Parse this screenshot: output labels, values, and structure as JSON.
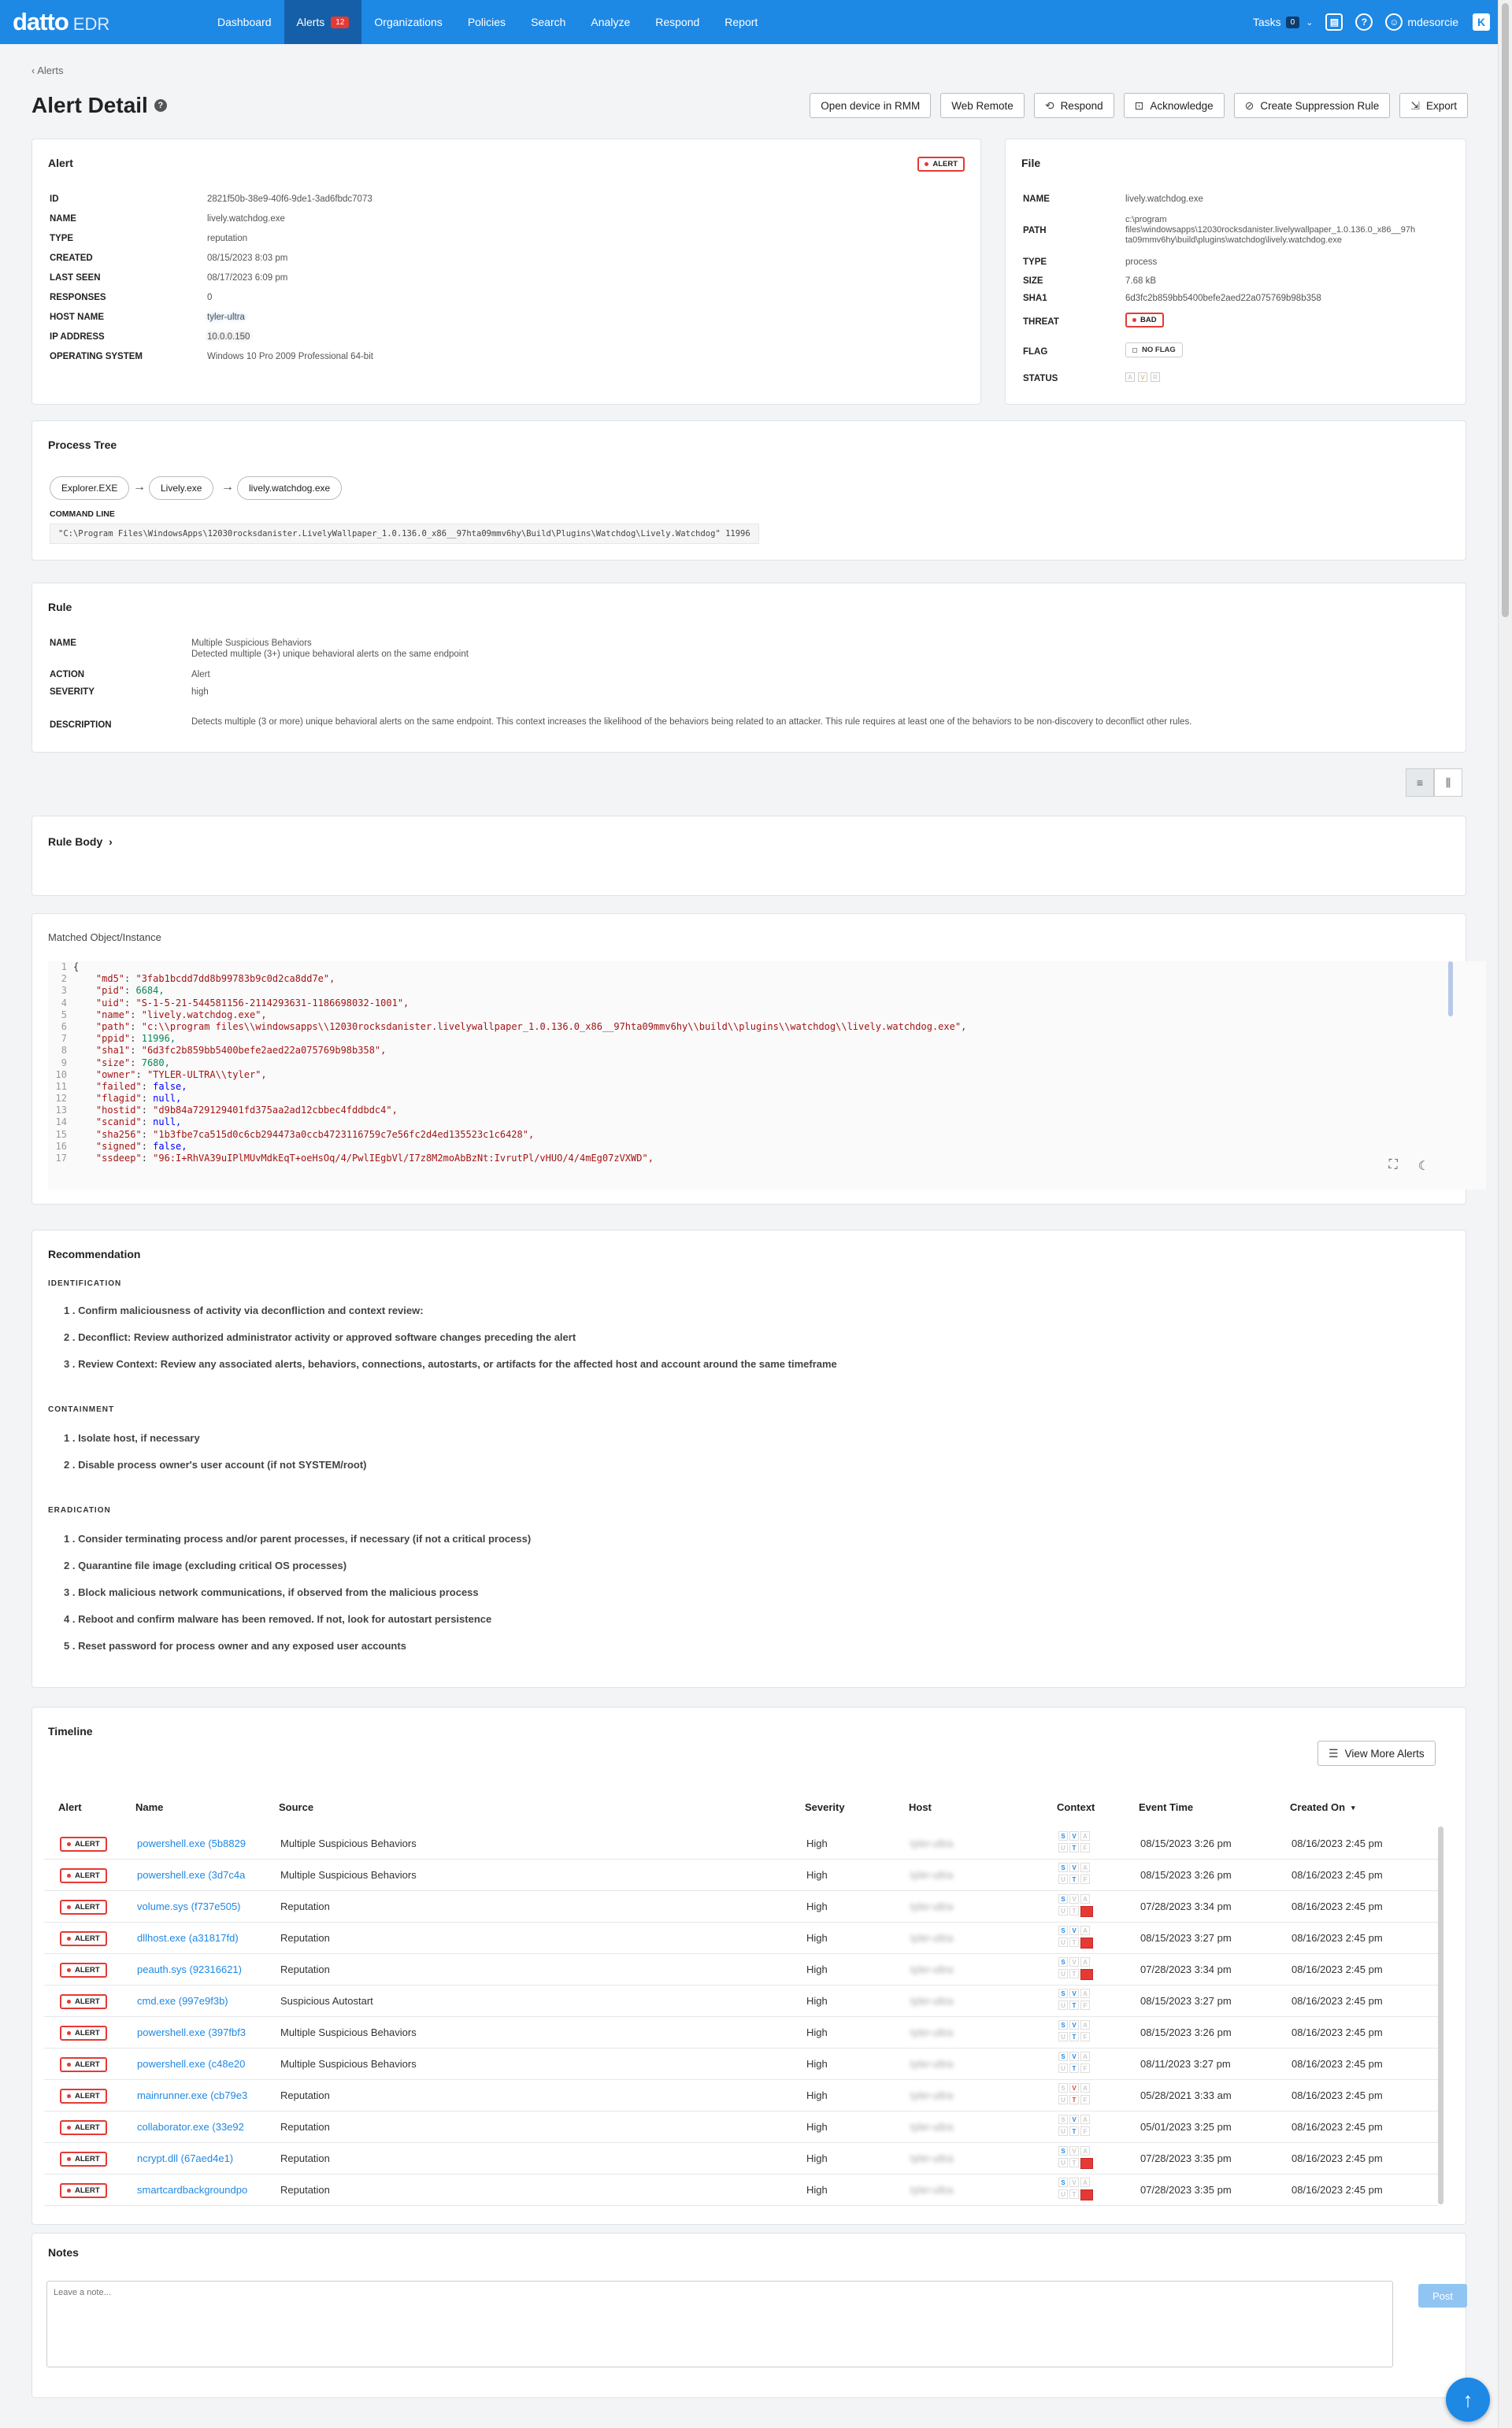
{
  "app": {
    "brand": "datto",
    "product": "EDR"
  },
  "nav": [
    {
      "label": "Dashboard"
    },
    {
      "label": "Alerts",
      "badge": "12"
    },
    {
      "label": "Organizations"
    },
    {
      "label": "Policies"
    },
    {
      "label": "Search"
    },
    {
      "label": "Analyze"
    },
    {
      "label": "Respond"
    },
    {
      "label": "Report"
    }
  ],
  "topbar": {
    "tasks_label": "Tasks",
    "tasks_count": "0",
    "username": "mdesorcie"
  },
  "breadcrumb": "Alerts",
  "page_title": "Alert Detail",
  "actions": {
    "open_rmm": "Open device in RMM",
    "web_remote": "Web Remote",
    "respond": "Respond",
    "acknowledge": "Acknowledge",
    "suppression": "Create Suppression Rule",
    "export": "Export"
  },
  "alert_card": {
    "title": "Alert",
    "badge": "ALERT",
    "fields": [
      {
        "k": "ID",
        "v": "2821f50b-38e9-40f6-9de1-3ad6fbdc7073"
      },
      {
        "k": "NAME",
        "v": "lively.watchdog.exe"
      },
      {
        "k": "TYPE",
        "v": "reputation"
      },
      {
        "k": "CREATED",
        "v": "08/15/2023 8:03 pm"
      },
      {
        "k": "LAST SEEN",
        "v": "08/17/2023 6:09 pm"
      },
      {
        "k": "RESPONSES",
        "v": "0"
      },
      {
        "k": "HOST NAME",
        "v": "tyler-ultra"
      },
      {
        "k": "IP ADDRESS",
        "v": "10.0.0.150"
      },
      {
        "k": "OPERATING SYSTEM",
        "v": "Windows 10 Pro 2009 Professional 64-bit"
      }
    ]
  },
  "file_card": {
    "title": "File",
    "name": "lively.watchdog.exe",
    "path": "c:\\program files\\windowsapps\\12030rocksdanister.livelywallpaper_1.0.136.0_x86__97hta09mmv6hy\\build\\plugins\\watchdog\\lively.watchdog.exe",
    "path_line1": "c:\\program",
    "path_line2": "files\\windowsapps\\12030rocksdanister.livelywallpaper_1.0.136.0_x86__97h",
    "path_line3": "ta09mmv6hy\\build\\plugins\\watchdog\\lively.watchdog.exe",
    "type": "process",
    "size": "7.68 kB",
    "sha1": "6d3fc2b859bb5400befe2aed22a075769b98b358",
    "threat": "BAD",
    "flag": "NO FLAG",
    "labels": {
      "name": "NAME",
      "path": "PATH",
      "type": "TYPE",
      "size": "SIZE",
      "sha1": "SHA1",
      "threat": "THREAT",
      "flag": "FLAG",
      "status": "STATUS"
    }
  },
  "process_tree": {
    "title": "Process Tree",
    "nodes": [
      "Explorer.EXE",
      "Lively.exe",
      "lively.watchdog.exe"
    ],
    "cmd_label": "COMMAND LINE",
    "cmd": "\"C:\\Program Files\\WindowsApps\\12030rocksdanister.LivelyWallpaper_1.0.136.0_x86__97hta09mmv6hy\\Build\\Plugins\\Watchdog\\Lively.Watchdog\" 11996"
  },
  "rule": {
    "title": "Rule",
    "labels": {
      "name": "NAME",
      "action": "ACTION",
      "severity": "SEVERITY",
      "description": "DESCRIPTION"
    },
    "name": "Multiple Suspicious Behaviors",
    "name_sub": "Detected multiple (3+) unique behavioral alerts on the same endpoint",
    "action": "Alert",
    "severity": "high",
    "description": "Detects multiple (3 or more) unique behavioral alerts on the same endpoint. This context increases the likelihood of the behaviors being related to an attacker. This rule requires at least one of the behaviors to be non-discovery to deconflict other rules."
  },
  "rule_body": {
    "title": "Rule Body"
  },
  "matched": {
    "title": "Matched Object/Instance",
    "lines": [
      {
        "n": "1",
        "k": "",
        "v": "{",
        "t": "p"
      },
      {
        "n": "2",
        "k": "\"md5\"",
        "v": "\"3fab1bcdd7dd8b99783b9c0d2ca8dd7e\",",
        "t": "str"
      },
      {
        "n": "3",
        "k": "\"pid\"",
        "v": "6684,",
        "t": "num"
      },
      {
        "n": "4",
        "k": "\"uid\"",
        "v": "\"S-1-5-21-544581156-2114293631-1186698032-1001\",",
        "t": "str"
      },
      {
        "n": "5",
        "k": "\"name\"",
        "v": "\"lively.watchdog.exe\",",
        "t": "str"
      },
      {
        "n": "6",
        "k": "\"path\"",
        "v": "\"c:\\\\program files\\\\windowsapps\\\\12030rocksdanister.livelywallpaper_1.0.136.0_x86__97hta09mmv6hy\\\\build\\\\plugins\\\\watchdog\\\\lively.watchdog.exe\",",
        "t": "str"
      },
      {
        "n": "7",
        "k": "\"ppid\"",
        "v": "11996,",
        "t": "num"
      },
      {
        "n": "8",
        "k": "\"sha1\"",
        "v": "\"6d3fc2b859bb5400befe2aed22a075769b98b358\",",
        "t": "str"
      },
      {
        "n": "9",
        "k": "\"size\"",
        "v": "7680,",
        "t": "num"
      },
      {
        "n": "10",
        "k": "\"owner\"",
        "v": "\"TYLER-ULTRA\\\\tyler\",",
        "t": "str"
      },
      {
        "n": "11",
        "k": "\"failed\"",
        "v": "false,",
        "t": "lit"
      },
      {
        "n": "12",
        "k": "\"flagid\"",
        "v": "null,",
        "t": "lit"
      },
      {
        "n": "13",
        "k": "\"hostid\"",
        "v": "\"d9b84a729129401fd375aa2ad12cbbec4fddbdc4\",",
        "t": "str"
      },
      {
        "n": "14",
        "k": "\"scanid\"",
        "v": "null,",
        "t": "lit"
      },
      {
        "n": "15",
        "k": "\"sha256\"",
        "v": "\"1b3fbe7ca515d0c6cb294473a0ccb4723116759c7e56fc2d4ed135523c1c6428\",",
        "t": "str"
      },
      {
        "n": "16",
        "k": "\"signed\"",
        "v": "false,",
        "t": "lit"
      },
      {
        "n": "17",
        "k": "\"ssdeep\"",
        "v": "\"96:I+RhVA39uIPlMUvMdkEqT+oeHsOq/4/PwlIEgbVl/I7z8M2moAbBzNt:IvrutPl/vHUO/4/4mEg07zVXWD\",",
        "t": "str"
      }
    ]
  },
  "recommendation": {
    "title": "Recommendation",
    "identification_label": "IDENTIFICATION",
    "identification": [
      "1 . Confirm maliciousness of activity via deconfliction and context review:",
      "2 . Deconflict: Review authorized administrator activity or approved software changes preceding the alert",
      "3 . Review Context: Review any associated alerts, behaviors, connections, autostarts, or artifacts for the affected host and account around the same timeframe"
    ],
    "containment_label": "CONTAINMENT",
    "containment": [
      "1 . Isolate host, if necessary",
      "2 . Disable process owner's user account (if not SYSTEM/root)"
    ],
    "eradication_label": "ERADICATION",
    "eradication": [
      "1 . Consider terminating process and/or parent processes, if necessary (if not a critical process)",
      "2 . Quarantine file image (excluding critical OS processes)",
      "3 . Block malicious network communications, if observed from the malicious process",
      "4 . Reboot and confirm malware has been removed. If not, look for autostart persistence",
      "5 . Reset password for process owner and any exposed user accounts"
    ]
  },
  "timeline": {
    "title": "Timeline",
    "view_more": "View More Alerts",
    "columns": [
      "Alert",
      "Name",
      "Source",
      "Severity",
      "Host",
      "Context",
      "Event Time",
      "Created On"
    ],
    "rows": [
      {
        "alert": "ALERT",
        "name": "powershell.exe (5b8829",
        "source": "Multiple Suspicious Behaviors",
        "severity": "High",
        "host": "tyler-ultra",
        "event": "08/15/2023 3:26 pm",
        "created": "08/16/2023 2:45 pm",
        "ctx": "svt"
      },
      {
        "alert": "ALERT",
        "name": "powershell.exe (3d7c4a",
        "source": "Multiple Suspicious Behaviors",
        "severity": "High",
        "host": "tyler-ultra",
        "event": "08/15/2023 3:26 pm",
        "created": "08/16/2023 2:45 pm",
        "ctx": "svt"
      },
      {
        "alert": "ALERT",
        "name": "volume.sys (f737e505)",
        "source": "Reputation",
        "severity": "High",
        "host": "tyler-ultra",
        "event": "07/28/2023 3:34 pm",
        "created": "08/16/2023 2:45 pm",
        "ctx": "sr"
      },
      {
        "alert": "ALERT",
        "name": "dllhost.exe (a31817fd)",
        "source": "Reputation",
        "severity": "High",
        "host": "tyler-ultra",
        "event": "08/15/2023 3:27 pm",
        "created": "08/16/2023 2:45 pm",
        "ctx": "svr"
      },
      {
        "alert": "ALERT",
        "name": "peauth.sys (92316621)",
        "source": "Reputation",
        "severity": "High",
        "host": "tyler-ultra",
        "event": "07/28/2023 3:34 pm",
        "created": "08/16/2023 2:45 pm",
        "ctx": "sr"
      },
      {
        "alert": "ALERT",
        "name": "cmd.exe (997e9f3b)",
        "source": "Suspicious Autostart",
        "severity": "High",
        "host": "tyler-ultra",
        "event": "08/15/2023 3:27 pm",
        "created": "08/16/2023 2:45 pm",
        "ctx": "svt"
      },
      {
        "alert": "ALERT",
        "name": "powershell.exe (397fbf3",
        "source": "Multiple Suspicious Behaviors",
        "severity": "High",
        "host": "tyler-ultra",
        "event": "08/15/2023 3:26 pm",
        "created": "08/16/2023 2:45 pm",
        "ctx": "svt"
      },
      {
        "alert": "ALERT",
        "name": "powershell.exe (c48e20",
        "source": "Multiple Suspicious Behaviors",
        "severity": "High",
        "host": "tyler-ultra",
        "event": "08/11/2023 3:27 pm",
        "created": "08/16/2023 2:45 pm",
        "ctx": "svt"
      },
      {
        "alert": "ALERT",
        "name": "mainrunner.exe (cb79e3",
        "source": "Reputation",
        "severity": "High",
        "host": "tyler-ultra",
        "event": "05/28/2021 3:33 am",
        "created": "08/16/2023 2:45 pm",
        "ctx": "vT"
      },
      {
        "alert": "ALERT",
        "name": "collaborator.exe (33e92",
        "source": "Reputation",
        "severity": "High",
        "host": "tyler-ultra",
        "event": "05/01/2023 3:25 pm",
        "created": "08/16/2023 2:45 pm",
        "ctx": "vt"
      },
      {
        "alert": "ALERT",
        "name": "ncrypt.dll (67aed4e1)",
        "source": "Reputation",
        "severity": "High",
        "host": "tyler-ultra",
        "event": "07/28/2023 3:35 pm",
        "created": "08/16/2023 2:45 pm",
        "ctx": "sr"
      },
      {
        "alert": "ALERT",
        "name": "smartcardbackgroundpo",
        "source": "Reputation",
        "severity": "High",
        "host": "tyler-ultra",
        "event": "07/28/2023 3:35 pm",
        "created": "08/16/2023 2:45 pm",
        "ctx": "sr"
      }
    ]
  },
  "notes": {
    "title": "Notes",
    "placeholder": "Leave a note...",
    "post": "Post"
  },
  "colors": {
    "primary": "#1e88e5",
    "nav_active": "#155fa8",
    "alert_red": "#e53935"
  }
}
